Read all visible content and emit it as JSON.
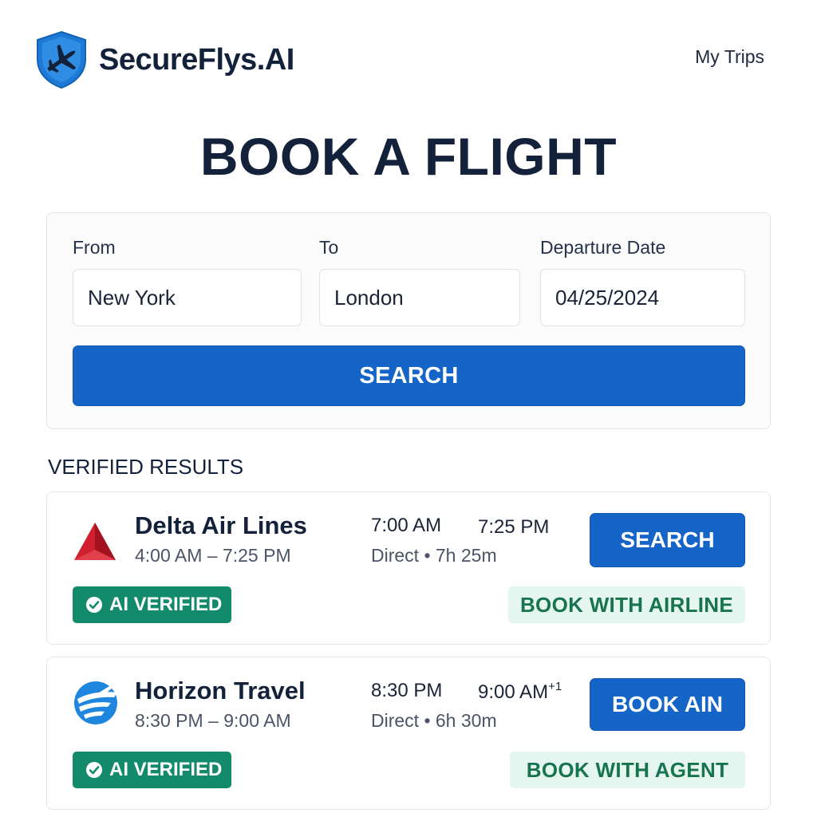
{
  "header": {
    "brand": "SecureFlys.AI",
    "logo_icon": "shield-plane-icon",
    "nav_my_trips": "My Trips"
  },
  "page_title": "BOOK A FLIGHT",
  "search": {
    "from_label": "From",
    "from_value": "New York",
    "to_label": "To",
    "to_value": "London",
    "date_label": "Departure Date",
    "date_value": "04/25/2024",
    "search_button": "SEARCH"
  },
  "results_title": "VERIFIED RESULTS",
  "results": [
    {
      "airline": "Delta Air Lines",
      "logo_icon": "delta-triangle-icon",
      "time_range": "4:00 AM – 7:25 PM",
      "departure": "7:00 AM",
      "arrival": "7:25 PM",
      "arrival_suffix": "",
      "route": "Direct • 7h 25m",
      "button": "SEARCH",
      "badge": "AI VERIFIED",
      "channel": "BOOK WITH AIRLINE"
    },
    {
      "airline": "Horizon Travel",
      "logo_icon": "globe-plane-icon",
      "time_range": "8:30 PM – 9:00 AM",
      "departure": "8:30 PM",
      "arrival": "9:00 AM",
      "arrival_suffix": "+1",
      "route": "Direct • 6h 30m",
      "button": "BOOK AIN",
      "badge": "AI VERIFIED",
      "channel": "BOOK WITH AGENT"
    }
  ],
  "colors": {
    "primary": "#1565c9",
    "verified": "#148a6c",
    "channel_bg": "#e5f6f1",
    "channel_text": "#17744f",
    "text_dark": "#13213a",
    "delta_red": "#d0202f"
  }
}
